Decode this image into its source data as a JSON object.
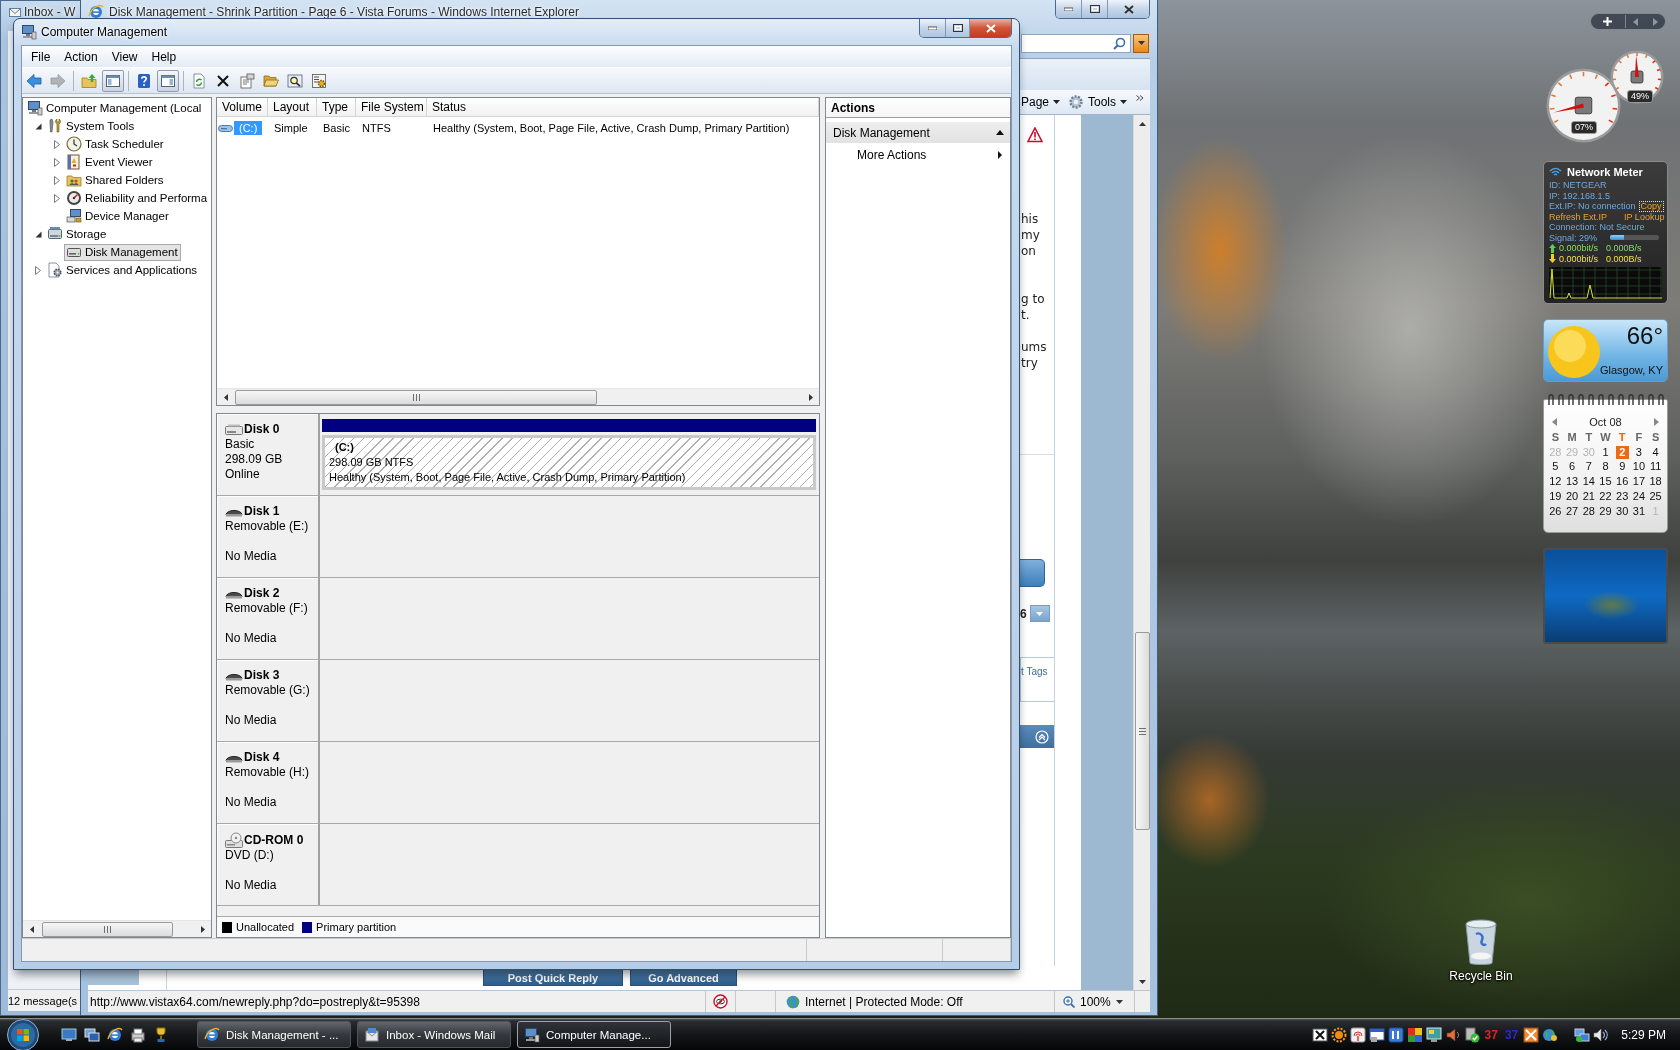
{
  "mail_window": {
    "title": "Inbox - W",
    "status": "12 message(s"
  },
  "browser": {
    "title": "Disk Management - Shrink Partition - Page 6 - Vista Forums - Windows Internet Explorer",
    "active": false,
    "commands": [
      "Page",
      "Tools"
    ],
    "post_fragments": [
      [
        "his",
        "my",
        "on"
      ],
      [
        "g to",
        "t."
      ],
      [
        "ums",
        "try"
      ]
    ],
    "page_number": "6",
    "tags_link": "t Tags",
    "buttons": [
      "Post Quick Reply",
      "Go Advanced"
    ],
    "status_bar": {
      "url": "http://www.vistax64.com/newreply.php?do=postreply&t=95398",
      "zone": "Internet | Protected Mode: Off",
      "zoom": "100%"
    }
  },
  "computer_management": {
    "title": "Computer Management",
    "active": true,
    "menu": [
      "File",
      "Action",
      "View",
      "Help"
    ],
    "toolbar": [
      [
        {
          "kind": "back",
          "pressed": false,
          "disabled": false
        },
        {
          "kind": "forward",
          "pressed": false,
          "disabled": true
        }
      ],
      [
        {
          "kind": "up",
          "pressed": false,
          "disabled": false
        },
        {
          "kind": "tree",
          "pressed": true,
          "disabled": false
        }
      ],
      [
        {
          "kind": "help",
          "pressed": false,
          "disabled": false
        },
        {
          "kind": "pane",
          "pressed": true,
          "disabled": false
        }
      ],
      [
        {
          "kind": "refresh",
          "pressed": false,
          "disabled": false
        },
        {
          "kind": "delete",
          "pressed": false,
          "disabled": false
        },
        {
          "kind": "properties",
          "pressed": false,
          "disabled": false
        },
        {
          "kind": "open",
          "pressed": false,
          "disabled": false
        },
        {
          "kind": "find",
          "pressed": false,
          "disabled": false
        },
        {
          "kind": "settings",
          "pressed": false,
          "disabled": false
        }
      ]
    ],
    "tree": [
      {
        "label": "Computer Management (Local",
        "kind": "computer",
        "expandable": false,
        "selected": false,
        "children": [
          {
            "label": "System Tools",
            "kind": "tools",
            "expandable": true,
            "expanded": true,
            "selected": false,
            "children": [
              {
                "label": "Task Scheduler",
                "kind": "clock",
                "expandable": true,
                "expanded": false,
                "selected": false
              },
              {
                "label": "Event Viewer",
                "kind": "log",
                "expandable": true,
                "expanded": false,
                "selected": false
              },
              {
                "label": "Shared Folders",
                "kind": "share",
                "expandable": true,
                "expanded": false,
                "selected": false
              },
              {
                "label": "Reliability and Performa",
                "kind": "gauge",
                "expandable": true,
                "expanded": false,
                "selected": false
              },
              {
                "label": "Device Manager",
                "kind": "devices",
                "expandable": false,
                "selected": false
              }
            ]
          },
          {
            "label": "Storage",
            "kind": "storage",
            "expandable": true,
            "expanded": true,
            "selected": false,
            "children": [
              {
                "label": "Disk Management",
                "kind": "disk",
                "expandable": false,
                "selected": true
              }
            ]
          },
          {
            "label": "Services and Applications",
            "kind": "services",
            "expandable": true,
            "expanded": false,
            "selected": false
          }
        ]
      }
    ],
    "volumes": {
      "columns": [
        "Volume",
        "Layout",
        "Type",
        "File System",
        "Status"
      ],
      "rows": [
        {
          "cells": [
            "(C:)",
            "Simple",
            "Basic",
            "NTFS",
            "Healthy (System, Boot, Page File, Active, Crash Dump, Primary Partition)"
          ],
          "selected": true
        }
      ]
    },
    "disks": [
      {
        "name": "Disk 0",
        "kind": "hdd",
        "type": "Basic",
        "size": "298.09 GB",
        "status": "Online",
        "partitions": [
          {
            "kind": "primary",
            "label": "(C:)",
            "size": "298.09 GB NTFS",
            "status": "Healthy (System, Boot, Page File, Active, Crash Dump, Primary Partition)"
          }
        ]
      },
      {
        "name": "Disk 1",
        "kind": "removable",
        "type": "Removable (E:)",
        "status": "No Media"
      },
      {
        "name": "Disk 2",
        "kind": "removable",
        "type": "Removable (F:)",
        "status": "No Media"
      },
      {
        "name": "Disk 3",
        "kind": "removable",
        "type": "Removable (G:)",
        "status": "No Media"
      },
      {
        "name": "Disk 4",
        "kind": "removable",
        "type": "Removable (H:)",
        "status": "No Media"
      },
      {
        "name": "CD-ROM 0",
        "kind": "cdrom",
        "type": "DVD (D:)",
        "status": "No Media"
      }
    ],
    "legend": [
      {
        "label": "Unallocated",
        "color": "#000000"
      },
      {
        "label": "Primary partition",
        "color": "#000080"
      }
    ],
    "actions": {
      "title": "Actions",
      "sections": [
        {
          "label": "Disk Management",
          "expanded": true,
          "items": [
            "More Actions"
          ]
        }
      ]
    }
  },
  "gadgets": {
    "cpu_meter": {
      "dials": [
        {
          "reading": "07%",
          "level": 0.07
        },
        {
          "reading": "49%",
          "level": 0.49
        }
      ]
    },
    "network_meter": {
      "title": "Network Meter",
      "id": "ID: NETGEAR",
      "ip": "IP: 192.168.1.5",
      "ext_ip": "Ext.IP: No connection",
      "copy": "Copy",
      "links": [
        "Refresh Ext.IP",
        "IP Lookup"
      ],
      "connection": "Connection: Not Secure",
      "signal": {
        "label": "Signal: 29%",
        "level": 0.29
      },
      "upload": [
        "0.000bit/s",
        "0.000B/s"
      ],
      "download": [
        "0.000bit/s",
        "0.000B/s"
      ]
    },
    "weather": {
      "temperature": "66°",
      "location": "Glasgow, KY"
    },
    "calendar": {
      "month": "Oct 08",
      "weekdays": [
        {
          "label": "S",
          "today": false
        },
        {
          "label": "M",
          "today": false
        },
        {
          "label": "T",
          "today": false
        },
        {
          "label": "W",
          "today": false
        },
        {
          "label": "T",
          "today": true
        },
        {
          "label": "F",
          "today": false
        },
        {
          "label": "S",
          "today": false
        }
      ],
      "weeks": [
        [
          {
            "day": "28",
            "muted": true,
            "today": false
          },
          {
            "day": "29",
            "muted": true,
            "today": false
          },
          {
            "day": "30",
            "muted": true,
            "today": false
          },
          {
            "day": "1",
            "muted": false,
            "today": false
          },
          {
            "day": "2",
            "muted": false,
            "today": true
          },
          {
            "day": "3",
            "muted": false,
            "today": false
          },
          {
            "day": "4",
            "muted": false,
            "today": false
          }
        ],
        [
          {
            "day": "5",
            "muted": false,
            "today": false
          },
          {
            "day": "6",
            "muted": false,
            "today": false
          },
          {
            "day": "7",
            "muted": false,
            "today": false
          },
          {
            "day": "8",
            "muted": false,
            "today": false
          },
          {
            "day": "9",
            "muted": false,
            "today": false
          },
          {
            "day": "10",
            "muted": false,
            "today": false
          },
          {
            "day": "11",
            "muted": false,
            "today": false
          }
        ],
        [
          {
            "day": "12",
            "muted": false,
            "today": false
          },
          {
            "day": "13",
            "muted": false,
            "today": false
          },
          {
            "day": "14",
            "muted": false,
            "today": false
          },
          {
            "day": "15",
            "muted": false,
            "today": false
          },
          {
            "day": "16",
            "muted": false,
            "today": false
          },
          {
            "day": "17",
            "muted": false,
            "today": false
          },
          {
            "day": "18",
            "muted": false,
            "today": false
          }
        ],
        [
          {
            "day": "19",
            "muted": false,
            "today": false
          },
          {
            "day": "20",
            "muted": false,
            "today": false
          },
          {
            "day": "21",
            "muted": false,
            "today": false
          },
          {
            "day": "22",
            "muted": false,
            "today": false
          },
          {
            "day": "23",
            "muted": false,
            "today": false
          },
          {
            "day": "24",
            "muted": false,
            "today": false
          },
          {
            "day": "25",
            "muted": false,
            "today": false
          }
        ],
        [
          {
            "day": "26",
            "muted": false,
            "today": false
          },
          {
            "day": "27",
            "muted": false,
            "today": false
          },
          {
            "day": "28",
            "muted": false,
            "today": false
          },
          {
            "day": "29",
            "muted": false,
            "today": false
          },
          {
            "day": "30",
            "muted": false,
            "today": false
          },
          {
            "day": "31",
            "muted": false,
            "today": false
          },
          {
            "day": "1",
            "muted": true,
            "today": false
          }
        ]
      ]
    }
  },
  "desktop_icons": [
    {
      "label": "Recycle Bin"
    }
  ],
  "taskbar": {
    "buttons": [
      {
        "label": "Disk Management - ...",
        "kind": "browser",
        "selected": false
      },
      {
        "label": "Inbox - Windows Mail",
        "kind": "mail",
        "selected": false
      },
      {
        "label": "Computer Manage...",
        "kind": "console",
        "selected": true
      }
    ],
    "tray_counters": [
      {
        "text": "37",
        "color": "#e02424"
      },
      {
        "text": "37",
        "color": "#2a2ad0"
      }
    ],
    "clock": "5:29 PM"
  }
}
